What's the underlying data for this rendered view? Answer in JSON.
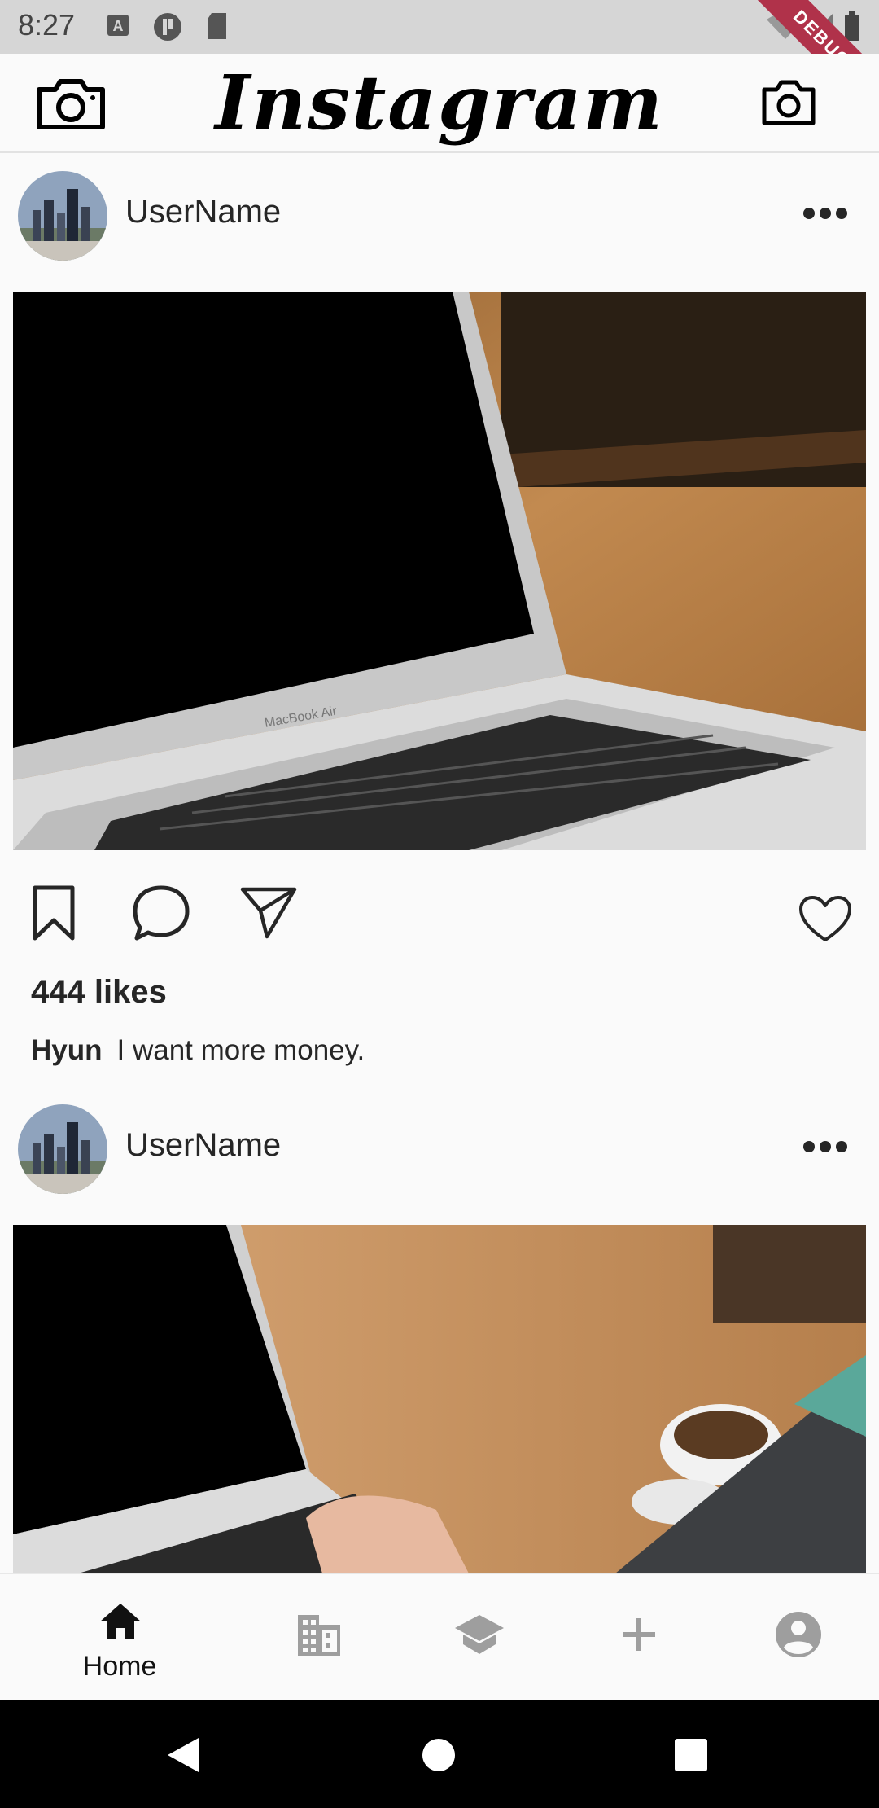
{
  "status_bar": {
    "time": "8:27",
    "icons": [
      "a-notification-icon",
      "circle-notification-icon",
      "sd-card-icon",
      "wifi-icon",
      "signal-icon",
      "battery-icon"
    ],
    "debug_banner": "DEBUG"
  },
  "app_bar": {
    "title": "Instagram",
    "left_icon": "camera-icon",
    "right_icon": "camera-outline-icon"
  },
  "posts": [
    {
      "username": "UserName",
      "likes": "444 likes",
      "caption_author": "Hyun",
      "caption_text": "I want more money."
    },
    {
      "username": "UserName"
    }
  ],
  "bottom_nav": {
    "items": [
      {
        "label": "Home",
        "icon": "home-icon",
        "active": true
      },
      {
        "label": "",
        "icon": "building-icon",
        "active": false
      },
      {
        "label": "",
        "icon": "school-icon",
        "active": false
      },
      {
        "label": "",
        "icon": "add-icon",
        "active": false
      },
      {
        "label": "",
        "icon": "account-circle-icon",
        "active": false
      }
    ]
  },
  "colors": {
    "status_bar_bg": "#d6d6d6",
    "background": "#fafafa",
    "debug_ribbon": "#b0324a",
    "text": "#262626",
    "inactive_icon": "#9e9e9e"
  }
}
